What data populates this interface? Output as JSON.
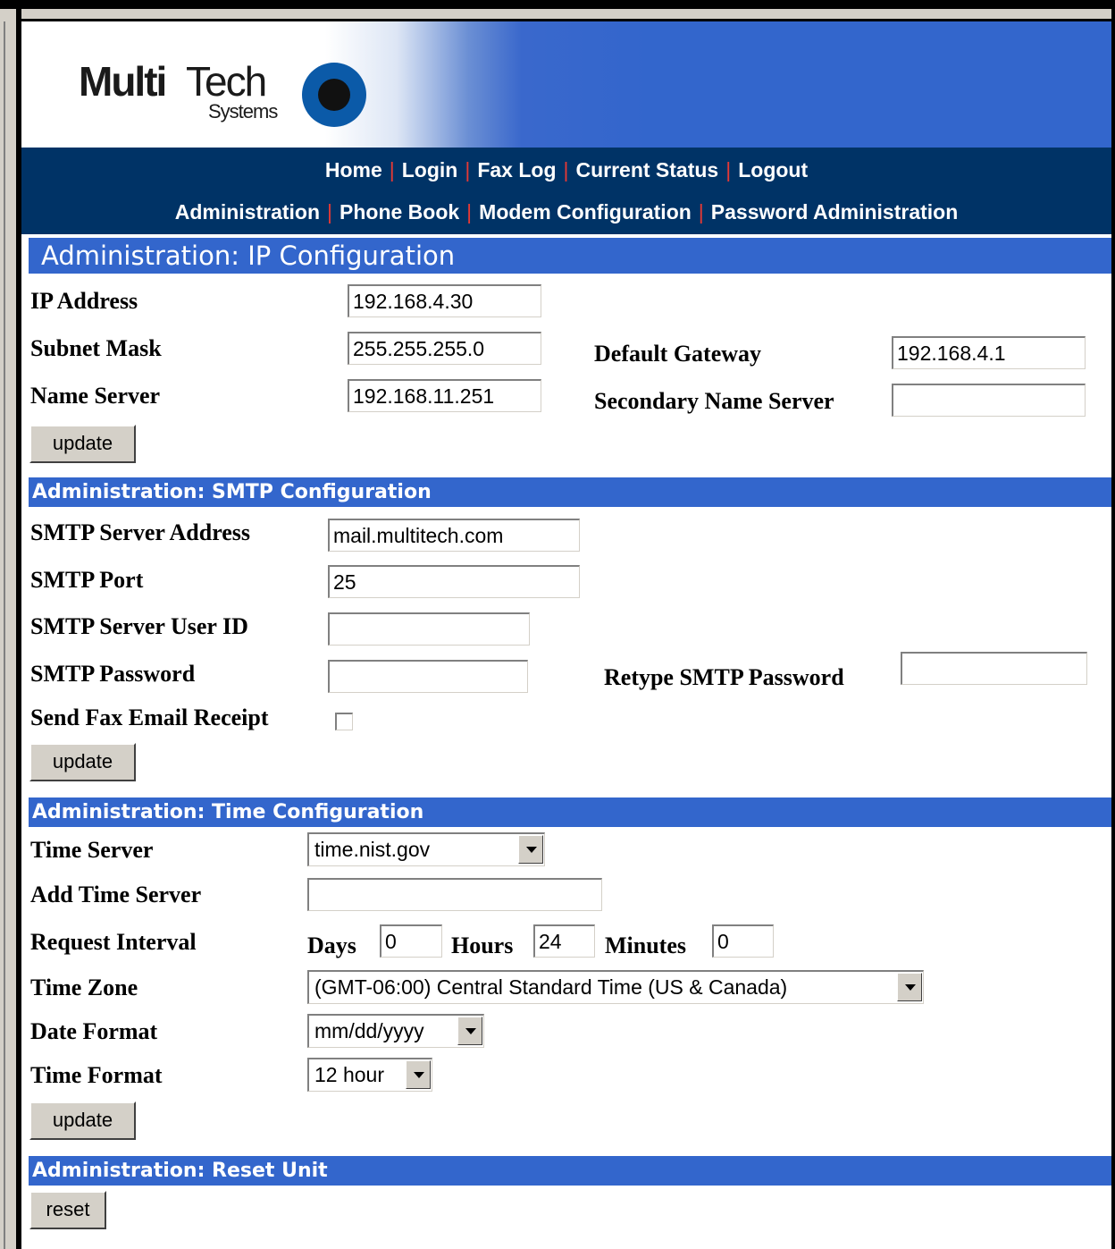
{
  "logo": {
    "brand": "MultiTech Systems",
    "multi": "Multi",
    "tech": "Tech",
    "systems": "Systems"
  },
  "nav": {
    "row1": [
      "Home",
      "Login",
      "Fax Log",
      "Current Status",
      "Logout"
    ],
    "row2": [
      "Administration",
      "Phone Book",
      "Modem Configuration",
      "Password Administration"
    ]
  },
  "ip": {
    "title": "Administration: IP Configuration",
    "ip_label": "IP Address",
    "ip_value": "192.168.4.30",
    "subnet_label": "Subnet Mask",
    "subnet_value": "255.255.255.0",
    "gateway_label": "Default Gateway",
    "gateway_value": "192.168.4.1",
    "ns_label": "Name Server",
    "ns_value": "192.168.11.251",
    "ns2_label": "Secondary Name Server",
    "ns2_value": "",
    "update": "update"
  },
  "smtp": {
    "title": "Administration: SMTP Configuration",
    "server_label": "SMTP Server Address",
    "server_value": "mail.multitech.com",
    "port_label": "SMTP Port",
    "port_value": "25",
    "user_label": "SMTP Server User ID",
    "user_value": "",
    "pass_label": "SMTP Password",
    "pass_value": "",
    "repass_label": "Retype SMTP Password",
    "repass_value": "",
    "receipt_label": "Send Fax Email Receipt",
    "receipt_checked": false,
    "update": "update"
  },
  "time": {
    "title": "Administration: Time Configuration",
    "server_label": "Time Server",
    "server_value": "time.nist.gov",
    "add_label": "Add Time Server",
    "add_value": "",
    "interval_label": "Request Interval",
    "days_label": "Days",
    "days_value": "0",
    "hours_label": "Hours",
    "hours_value": "24",
    "minutes_label": "Minutes",
    "minutes_value": "0",
    "zone_label": "Time Zone",
    "zone_value": "(GMT-06:00) Central Standard Time (US & Canada)",
    "date_label": "Date Format",
    "date_value": "mm/dd/yyyy",
    "tformat_label": "Time Format",
    "tformat_value": "12 hour",
    "update": "update"
  },
  "reset": {
    "title": "Administration: Reset Unit",
    "button": "reset"
  }
}
